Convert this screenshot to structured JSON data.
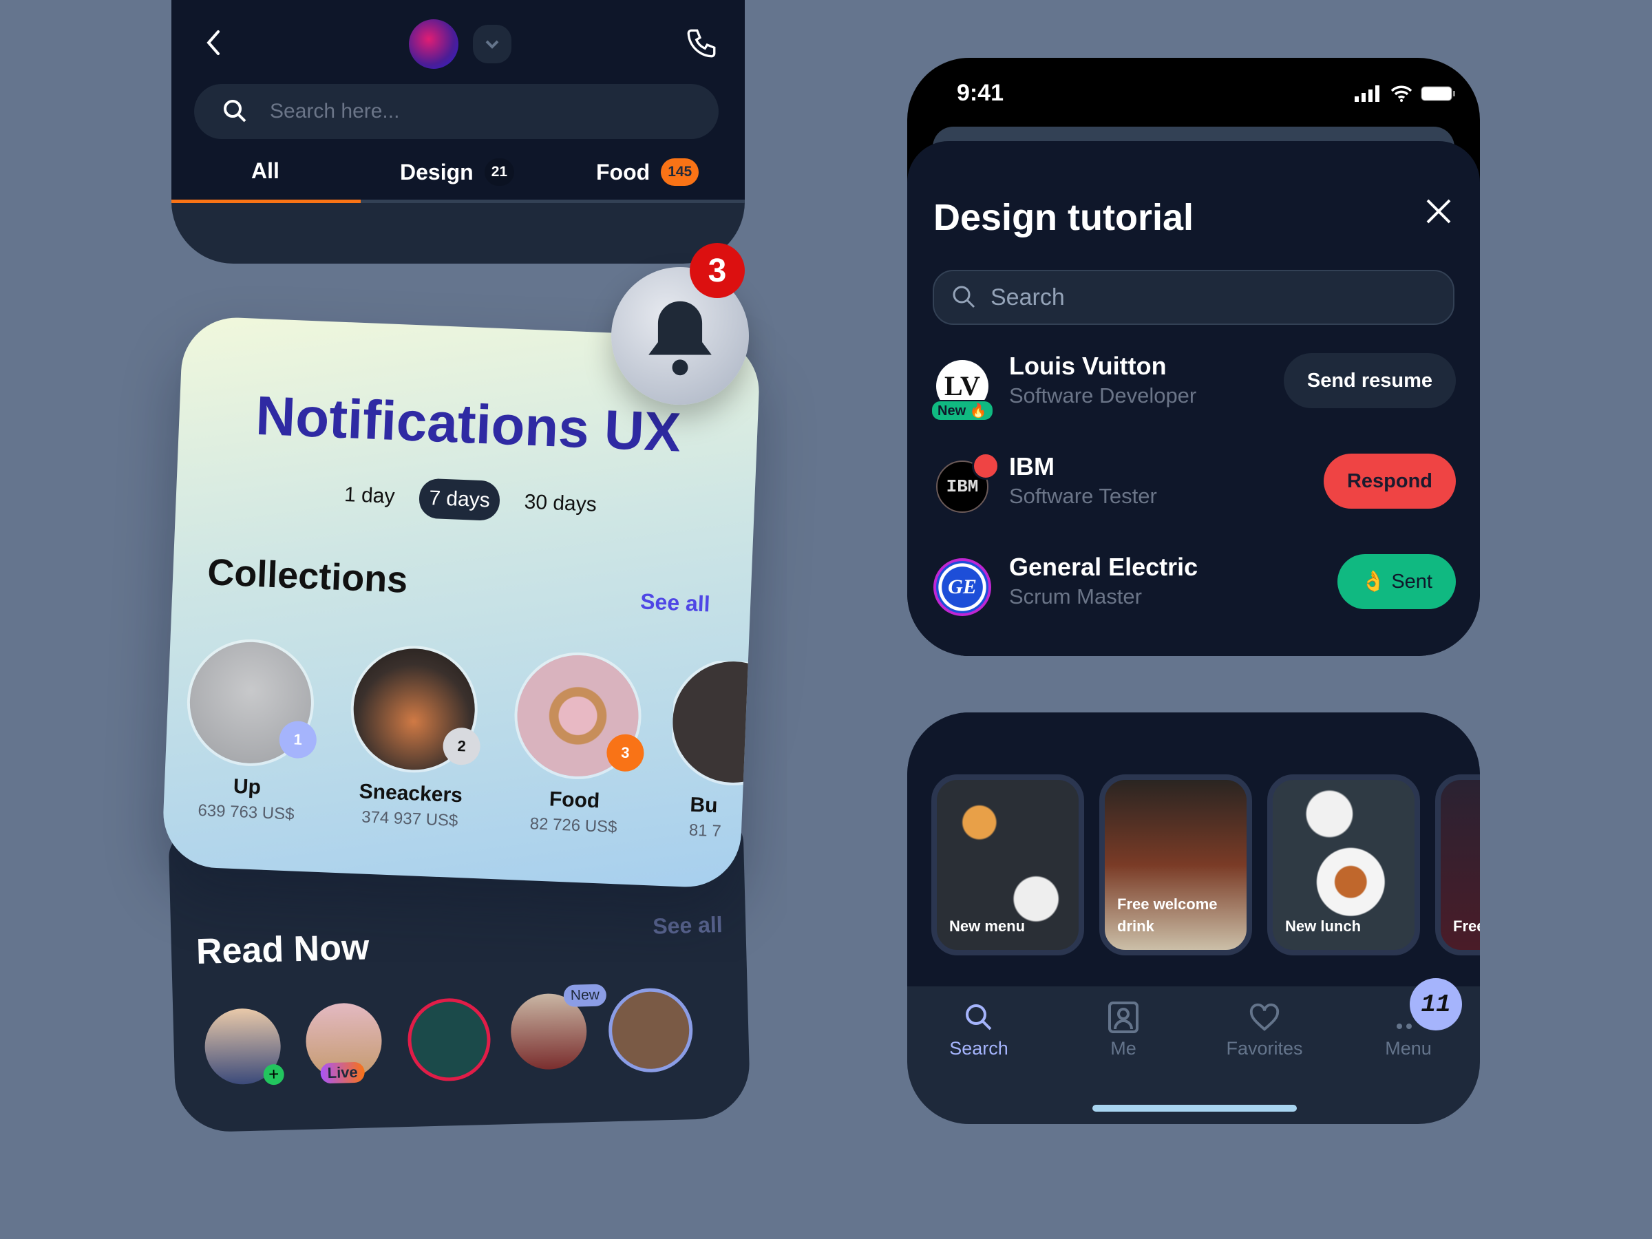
{
  "top_card": {
    "search_placeholder": "Search here...",
    "tabs": [
      {
        "label": "All",
        "active": true
      },
      {
        "label": "Design",
        "badge": "21"
      },
      {
        "label": "Food",
        "badge": "145"
      }
    ],
    "accent": "#f97316"
  },
  "notifications": {
    "title": "Notifications UX",
    "bell_badge": "3",
    "periods": [
      "1 day",
      "7 days",
      "30 days"
    ],
    "selected_period": "7 days",
    "collections_title": "Collections",
    "see_all": "See all",
    "collections": [
      {
        "rank": "1",
        "name": "Up",
        "price": "639 763 US$"
      },
      {
        "rank": "2",
        "name": "Sneackers",
        "price": "374 937 US$"
      },
      {
        "rank": "3",
        "name": "Food",
        "price": "82 726 US$"
      },
      {
        "name": "Bu",
        "price": "81 7"
      }
    ]
  },
  "read_now": {
    "title": "Read Now",
    "see_all": "See all",
    "badges": {
      "live": "Live",
      "new": "New"
    }
  },
  "jobs": {
    "time": "9:41",
    "title": "Design tutorial",
    "search_placeholder": "Search",
    "rows": [
      {
        "company": "Louis Vuitton",
        "role": "Software Developer",
        "tag": "New 🔥",
        "action": "Send resume"
      },
      {
        "company": "IBM",
        "role": "Software Tester",
        "action": "Respond"
      },
      {
        "company": "General Electric",
        "role": "Scrum Master",
        "action": "👌 Sent"
      }
    ]
  },
  "food": {
    "cards": [
      "New menu",
      "Free welcome drink",
      "New lunch",
      "Free drink"
    ],
    "nav": [
      {
        "label": "Search",
        "active": true
      },
      {
        "label": "Me"
      },
      {
        "label": "Favorites"
      },
      {
        "label": "Menu",
        "badge": "11"
      }
    ]
  }
}
